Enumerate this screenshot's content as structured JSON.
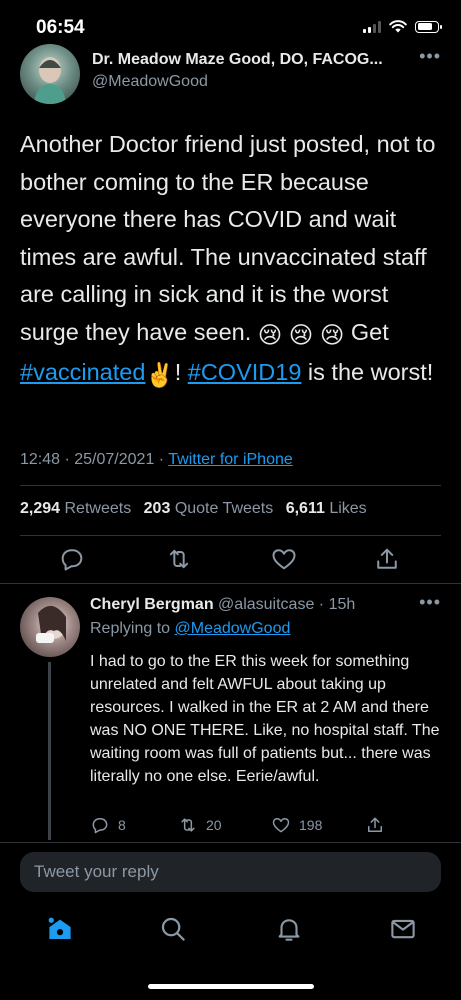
{
  "status_bar": {
    "time": "06:54"
  },
  "tweet": {
    "author_name": "Dr. Meadow Maze Good, DO, FACOG...",
    "author_handle": "@MeadowGood",
    "text_pre": "Another Doctor friend just posted, not to bother coming to the ER because everyone there has COVID and wait times are awful. The unvaccinated staff are calling in sick and it is the worst surge they have seen. ",
    "emojis_1": "😢 😢 😢",
    "text_get": " Get ",
    "hashtag_1": "#vaccinated",
    "emoji_2": "✌️",
    "text_mid": "! ",
    "hashtag_2": "#COVID19",
    "text_end": " is the worst!",
    "timestamp": "12:48 · 25/07/2021 · ",
    "source": "Twitter for iPhone",
    "retweets_count": "2,294",
    "retweets_label": "Retweets",
    "quotes_count": "203",
    "quotes_label": "Quote Tweets",
    "likes_count": "6,611",
    "likes_label": "Likes"
  },
  "reply": {
    "name": "Cheryl Bergman",
    "handle": "@alasuitcase",
    "time": "15h",
    "replying_to_label": "Replying to ",
    "replying_to_handle": "@MeadowGood",
    "text": "I had to go to the ER this week for something unrelated and felt AWFUL about taking up resources. I walked in the ER at 2 AM and there was NO ONE THERE. Like, no hospital staff. The waiting room was full of patients but... there was literally no one else. Eerie/awful.",
    "reply_count": "8",
    "retweet_count": "20",
    "like_count": "198"
  },
  "composer": {
    "placeholder": "Tweet your reply"
  },
  "icons": {
    "more": "more-horizontal-icon",
    "reply": "comment-icon",
    "retweet": "retweet-icon",
    "like": "heart-icon",
    "share": "share-icon",
    "home": "home-icon",
    "search": "search-icon",
    "notifications": "bell-icon",
    "messages": "mail-icon"
  },
  "colors": {
    "accent": "#1d9bf0",
    "background": "#000000",
    "muted": "#8b98a5"
  }
}
